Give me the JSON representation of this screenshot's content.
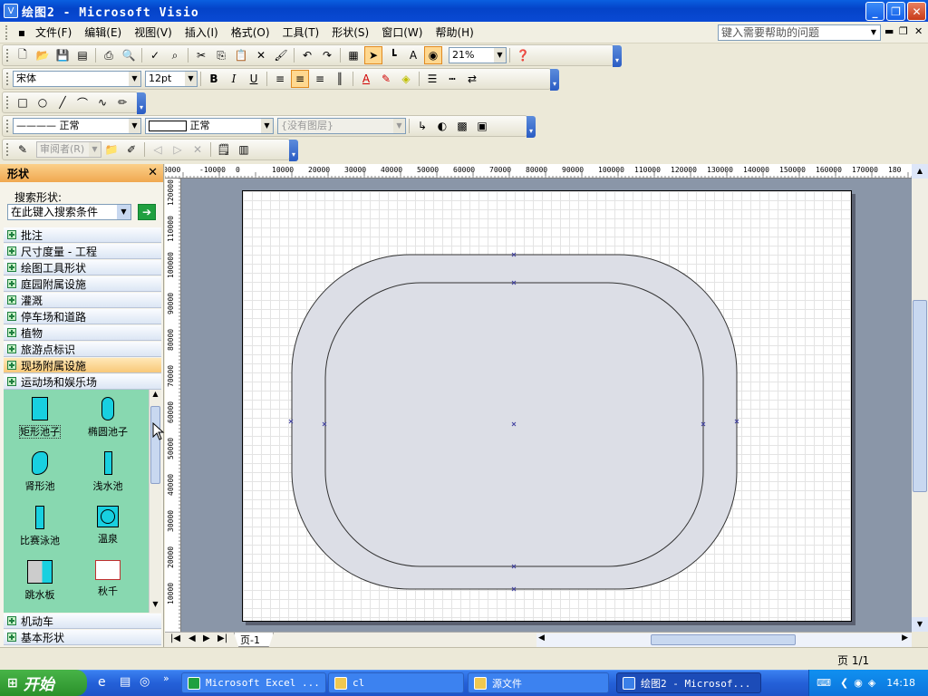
{
  "window": {
    "title": "绘图2 - Microsoft Visio"
  },
  "menu": {
    "items": [
      "文件(F)",
      "编辑(E)",
      "视图(V)",
      "插入(I)",
      "格式(O)",
      "工具(T)",
      "形状(S)",
      "窗口(W)",
      "帮助(H)"
    ],
    "help_placeholder": "键入需要帮助的问题"
  },
  "toolbar": {
    "zoom": "21%",
    "font": "宋体",
    "size": "12pt",
    "line_style": "正常",
    "fill_style": "正常",
    "layer": "{没有图层}",
    "reviewer": "审阅者(R)"
  },
  "panel": {
    "title": "形状",
    "search_label": "搜索形状:",
    "search_value": "在此键入搜索条件",
    "categories": [
      "批注",
      "尺寸度量 - 工程",
      "绘图工具形状",
      "庭园附属设施",
      "灌溉",
      "停车场和道路",
      "植物",
      "旅游点标识",
      "现场附属设施",
      "运动场和娱乐场"
    ],
    "shapes": [
      "矩形池子",
      "椭圆池子",
      "肾形池",
      "浅水池",
      "比赛泳池",
      "温泉",
      "跳水板",
      "秋千"
    ],
    "bottom_categories": [
      "机动车",
      "基本形状"
    ]
  },
  "ruler": {
    "top_labels": [
      "0000",
      "-10000",
      "0",
      "10000",
      "20000",
      "30000",
      "40000",
      "50000",
      "60000",
      "70000",
      "80000",
      "90000",
      "100000",
      "110000",
      "120000",
      "130000",
      "140000",
      "150000",
      "160000",
      "170000",
      "180"
    ],
    "left_labels": [
      "120000",
      "110000",
      "100000",
      "90000",
      "80000",
      "70000",
      "60000",
      "50000",
      "40000",
      "30000",
      "20000",
      "10000"
    ]
  },
  "tabs": {
    "page": "页-1"
  },
  "status": {
    "page": "页 1/1"
  },
  "taskbar": {
    "start": "开始",
    "tasks": [
      "Microsoft Excel ...",
      "cl",
      "源文件",
      "绘图2 - Microsof..."
    ],
    "clock": "14:18"
  },
  "colors": {
    "pool_fill": "#dcdee6",
    "stencil_bg": "#88d8b0",
    "shape_fill": "#18d0e0",
    "canvas_bg": "#8a96a8"
  }
}
